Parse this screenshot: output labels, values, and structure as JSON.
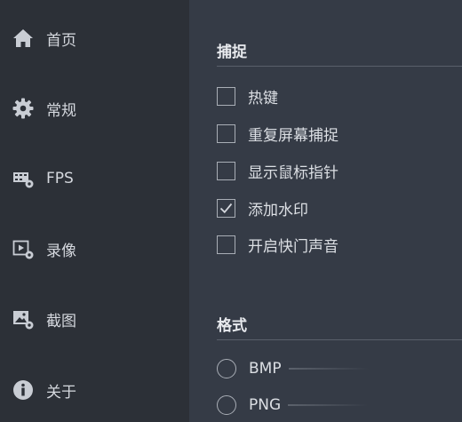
{
  "sidebar": {
    "items": [
      {
        "label": "首页",
        "icon": "home-icon"
      },
      {
        "label": "常规",
        "icon": "gear-icon"
      },
      {
        "label": "FPS",
        "icon": "fps-icon"
      },
      {
        "label": "录像",
        "icon": "video-settings-icon"
      },
      {
        "label": "截图",
        "icon": "screenshot-settings-icon"
      },
      {
        "label": "关于",
        "icon": "info-icon"
      }
    ]
  },
  "capture": {
    "title": "捕捉",
    "options": [
      {
        "label": "热键",
        "checked": false
      },
      {
        "label": "重复屏幕捕捉",
        "checked": false
      },
      {
        "label": "显示鼠标指针",
        "checked": false
      },
      {
        "label": "添加水印",
        "checked": true
      },
      {
        "label": "开启快门声音",
        "checked": false
      }
    ]
  },
  "format": {
    "title": "格式",
    "options": [
      {
        "label": "BMP",
        "selected": false
      },
      {
        "label": "PNG",
        "selected": false
      }
    ]
  },
  "colors": {
    "sidebar_bg": "#2c3037",
    "content_bg": "#353b46",
    "text": "#dcdfe4",
    "control_border": "#a9aeb6"
  }
}
